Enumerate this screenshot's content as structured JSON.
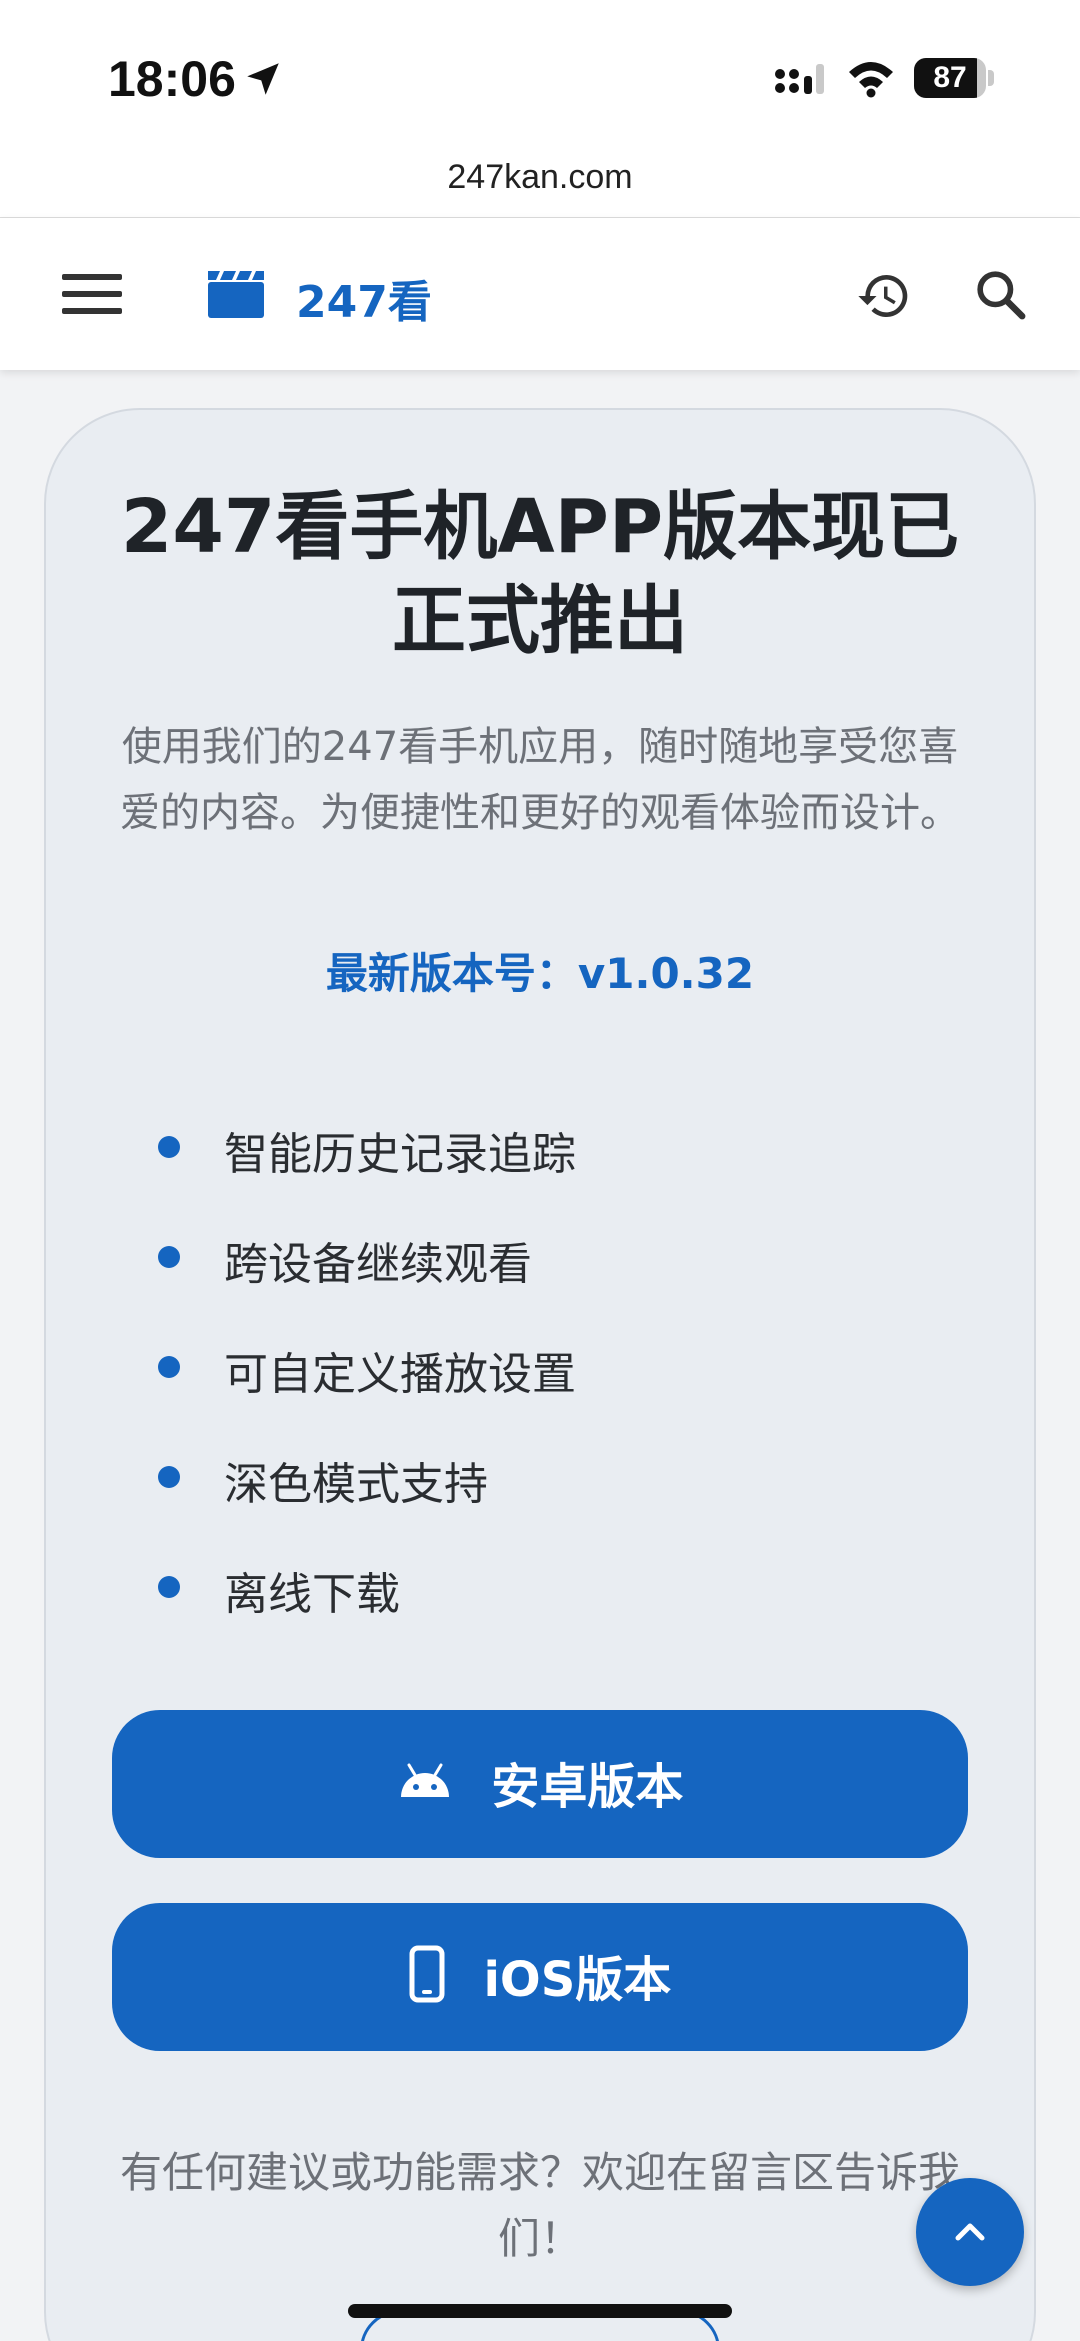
{
  "status_bar": {
    "time": "18:06",
    "battery": "87",
    "battery_level": 0.87
  },
  "browser": {
    "url": "247kan.com"
  },
  "header": {
    "brand": "247看",
    "icons": [
      "menu-icon",
      "clapperboard-icon",
      "history-icon",
      "search-icon"
    ]
  },
  "card": {
    "title": "247看手机APP版本现已正式推出",
    "subtitle": "使用我们的247看手机应用，随时随地享受您喜爱的内容。为便捷性和更好的观看体验而设计。",
    "version": "最新版本号：v1.0.32",
    "features": [
      "智能历史记录追踪",
      "跨设备继续观看",
      "可自定义播放设置",
      "深色模式支持",
      "离线下载"
    ],
    "android_button": "安卓版本",
    "ios_button": "iOS版本",
    "feedback": "有任何建议或功能需求？欢迎在留言区告诉我们！"
  },
  "colors": {
    "accent": "#1565c0",
    "card_bg": "#e9edf2",
    "page_bg": "#f2f3f5"
  }
}
